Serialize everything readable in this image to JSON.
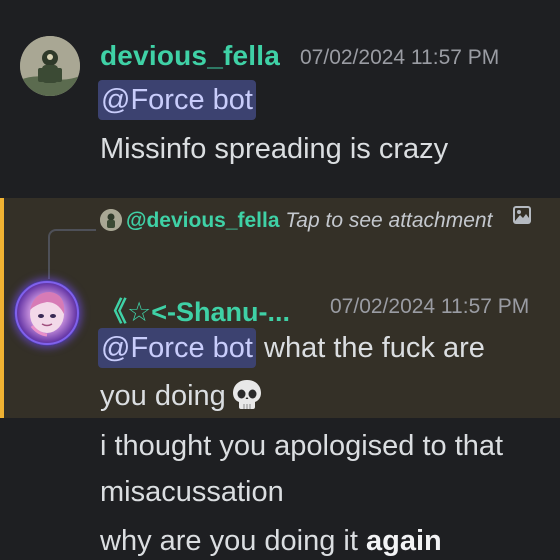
{
  "messages": [
    {
      "author": "devious_fella",
      "timestamp": "07/02/2024 11:57 PM",
      "mention": "@Force bot",
      "text": "Missinfo spreading is crazy",
      "avatar_icon": "avatar-devious-fella",
      "author_color": "#3fd1a6"
    },
    {
      "highlighted": true,
      "highlight_color": "#f0b232",
      "reply": {
        "author": "@devious_fella",
        "preview": "Tap to see attachment",
        "icon": "image-icon"
      },
      "author": "《☆<-Shanu-...",
      "timestamp": "07/02/2024 11:57 PM",
      "mention": "@Force bot",
      "text_line1": " what the fuck are",
      "text_line2": "you doing",
      "emoji": "skull-emoji",
      "avatar_icon": "avatar-shanu",
      "author_color": "#3fd1a6"
    }
  ],
  "continuation": {
    "line1": "i thought you apologised to that",
    "line2": "misacussation",
    "line3_prefix": "why are you doing it ",
    "line3_bold": "again"
  },
  "colors": {
    "background": "#1e1f22",
    "mention_bg": "#3c4270",
    "mention_text": "#c9cdfb",
    "highlight_bg": "#343027",
    "timestamp": "#9a9ca3"
  }
}
